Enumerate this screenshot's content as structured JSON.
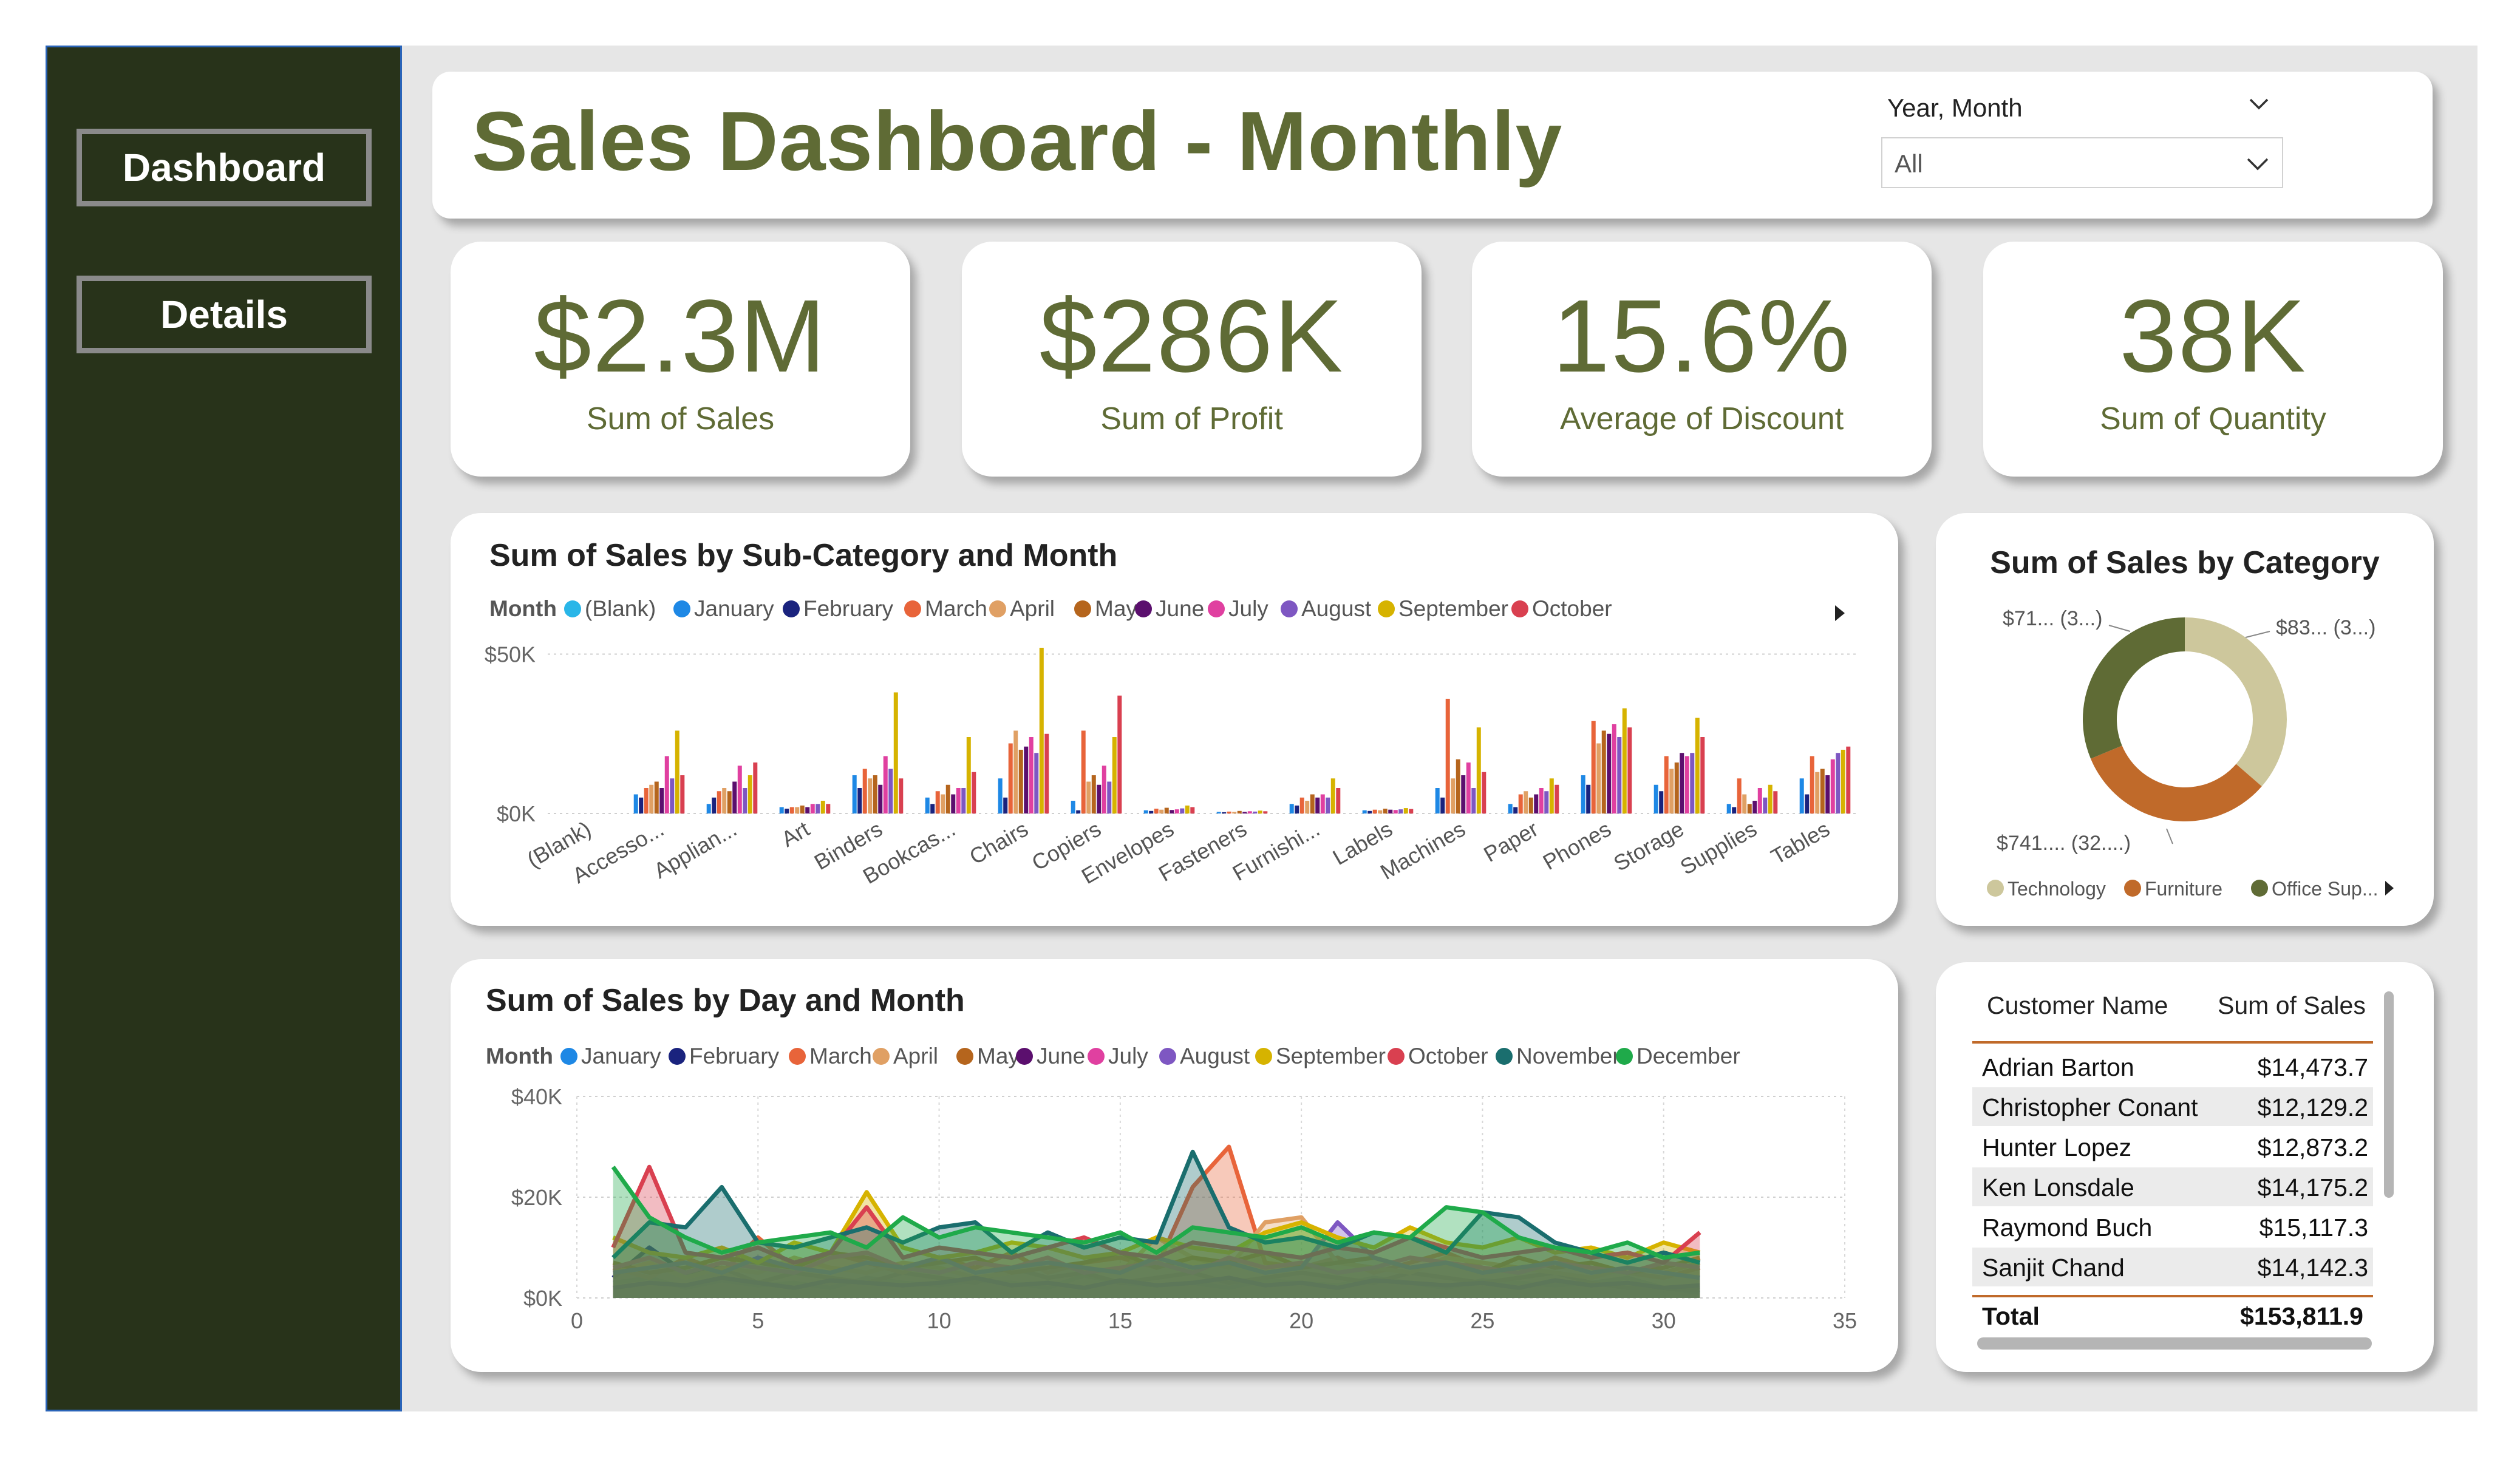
{
  "nav": {
    "dashboard_label": "Dashboard",
    "details_label": "Details"
  },
  "header": {
    "title": "Sales Dashboard - Monthly",
    "slicer_label": "Year, Month",
    "slicer_value": "All"
  },
  "kpis": [
    {
      "value": "$2.3M",
      "label": "Sum of Sales"
    },
    {
      "value": "$286K",
      "label": "Sum of Profit"
    },
    {
      "value": "15.6%",
      "label": "Average of Discount"
    },
    {
      "value": "38K",
      "label": "Sum of Quantity"
    }
  ],
  "colors": {
    "accent": "#5f6b35",
    "sidebar": "#28331a",
    "(Blank)": "#29b6e8",
    "January": "#1e88e5",
    "February": "#1a237e",
    "March": "#e8643a",
    "April": "#e0a064",
    "May": "#b5651d",
    "June": "#5b0f6e",
    "July": "#e040a0",
    "August": "#7e57c2",
    "September": "#d6b300",
    "October": "#d94050",
    "November": "#1a6e6e",
    "December": "#1faa4a",
    "Technology": "#cdc79c",
    "Furniture": "#c06a2a",
    "Office Supplies": "#5f6b35"
  },
  "chart_data": [
    {
      "type": "bar",
      "title": "Sum of Sales by Sub-Category and Month",
      "legend_title": "Month",
      "legend": [
        "(Blank)",
        "January",
        "February",
        "March",
        "April",
        "May",
        "June",
        "July",
        "August",
        "September",
        "October"
      ],
      "categories": [
        "(Blank)",
        "Accesso...",
        "Applian...",
        "Art",
        "Binders",
        "Bookcas...",
        "Chairs",
        "Copiers",
        "Envelopes",
        "Fasteners",
        "Furnishi...",
        "Labels",
        "Machines",
        "Paper",
        "Phones",
        "Storage",
        "Supplies",
        "Tables"
      ],
      "y_ticks": [
        "$0K",
        "$50K"
      ],
      "ylim": [
        0,
        60000
      ],
      "series": [
        {
          "name": "(Blank)",
          "values": [
            0,
            0,
            0,
            0,
            0,
            0,
            0,
            0,
            0,
            0,
            0,
            0,
            0,
            0,
            0,
            0,
            0,
            0
          ]
        },
        {
          "name": "January",
          "values": [
            0,
            6000,
            3000,
            2000,
            12000,
            5000,
            11000,
            4000,
            1000,
            500,
            3000,
            1000,
            8000,
            3000,
            12000,
            9000,
            3000,
            11000
          ]
        },
        {
          "name": "February",
          "values": [
            0,
            5000,
            5000,
            1500,
            8000,
            3000,
            5000,
            1000,
            800,
            400,
            2500,
            800,
            5000,
            2000,
            9000,
            7000,
            2000,
            6000
          ]
        },
        {
          "name": "March",
          "values": [
            0,
            8000,
            7000,
            2000,
            14000,
            7000,
            22000,
            26000,
            1500,
            600,
            5000,
            1200,
            36000,
            6000,
            29000,
            18000,
            11000,
            18000
          ]
        },
        {
          "name": "April",
          "values": [
            0,
            9000,
            8000,
            2000,
            11000,
            6000,
            26000,
            10000,
            1200,
            500,
            4000,
            1000,
            11000,
            7000,
            22000,
            14000,
            6000,
            13000
          ]
        },
        {
          "name": "May",
          "values": [
            0,
            10000,
            7000,
            2500,
            12000,
            9000,
            20000,
            12000,
            1800,
            800,
            6000,
            1500,
            17000,
            5000,
            26000,
            16000,
            3000,
            14000
          ]
        },
        {
          "name": "June",
          "values": [
            0,
            8000,
            10000,
            2000,
            9000,
            6000,
            21000,
            9000,
            1100,
            500,
            5000,
            1200,
            12000,
            6000,
            25000,
            19000,
            4000,
            12000
          ]
        },
        {
          "name": "July",
          "values": [
            0,
            18000,
            15000,
            3000,
            18000,
            8000,
            24000,
            15000,
            1300,
            700,
            6000,
            1100,
            16000,
            8000,
            28000,
            18000,
            8000,
            17000
          ]
        },
        {
          "name": "August",
          "values": [
            0,
            11000,
            8000,
            3000,
            14000,
            8000,
            19000,
            10000,
            1600,
            600,
            5000,
            1300,
            8000,
            7000,
            24000,
            19000,
            5000,
            19000
          ]
        },
        {
          "name": "September",
          "values": [
            0,
            26000,
            12000,
            4000,
            38000,
            24000,
            52000,
            24000,
            2500,
            900,
            11000,
            1700,
            27000,
            11000,
            33000,
            30000,
            9000,
            20000
          ]
        },
        {
          "name": "October",
          "values": [
            0,
            12000,
            16000,
            3000,
            11000,
            13000,
            25000,
            37000,
            2000,
            700,
            8000,
            1400,
            13000,
            9000,
            27000,
            24000,
            7000,
            21000
          ]
        }
      ]
    },
    {
      "type": "donut",
      "title": "Sum of Sales by Category",
      "slices": [
        {
          "name": "Technology",
          "value": 836154,
          "label": "$83... (3...)"
        },
        {
          "name": "Furniture",
          "value": 741999,
          "label": "$741.... (32....)"
        },
        {
          "name": "Office Supplies",
          "value": 719047,
          "label": "$71... (3...)"
        }
      ],
      "legend": [
        "Technology",
        "Furniture",
        "Office Sup..."
      ]
    },
    {
      "type": "area",
      "title": "Sum of Sales by Day and Month",
      "legend_title": "Month",
      "legend": [
        "January",
        "February",
        "March",
        "April",
        "May",
        "June",
        "July",
        "August",
        "September",
        "October",
        "November",
        "December"
      ],
      "x_ticks": [
        "0",
        "5",
        "10",
        "15",
        "20",
        "25",
        "30",
        "35"
      ],
      "y_ticks": [
        "$0K",
        "$20K",
        "$40K"
      ],
      "xlim": [
        0,
        35
      ],
      "ylim": [
        0,
        40000
      ],
      "x": [
        1,
        2,
        3,
        4,
        5,
        6,
        7,
        8,
        9,
        10,
        11,
        12,
        13,
        14,
        15,
        16,
        17,
        18,
        19,
        20,
        21,
        22,
        23,
        24,
        25,
        26,
        27,
        28,
        29,
        30,
        31
      ],
      "series": [
        {
          "name": "January",
          "values": [
            3000,
            4000,
            2000,
            3500,
            2500,
            3000,
            2000,
            4000,
            3000,
            2500,
            3500,
            3000,
            2000,
            4500,
            3000,
            2500,
            3000,
            2000,
            3500,
            3000,
            2500,
            4000,
            3000,
            2000,
            3500,
            3000,
            2500,
            3000,
            4000,
            2000,
            1000
          ]
        },
        {
          "name": "February",
          "values": [
            4000,
            10000,
            5000,
            6000,
            3000,
            5000,
            4000,
            3000,
            5000,
            4000,
            3000,
            6000,
            4000,
            5000,
            3000,
            4000,
            5000,
            3000,
            4000,
            5000,
            4000,
            3000,
            5000,
            4000,
            3000,
            4000,
            5000,
            3000,
            2000,
            2000,
            1500
          ]
        },
        {
          "name": "March",
          "values": [
            6000,
            4000,
            8000,
            5000,
            12000,
            6000,
            9000,
            7000,
            5000,
            8000,
            6000,
            9000,
            5000,
            7000,
            8000,
            6000,
            22000,
            30000,
            7000,
            6000,
            8000,
            5000,
            7000,
            9000,
            6000,
            5000,
            8000,
            6000,
            5000,
            4000,
            6000
          ]
        },
        {
          "name": "April",
          "values": [
            5000,
            7000,
            4000,
            6000,
            5000,
            8000,
            6000,
            5000,
            7000,
            6000,
            4000,
            5000,
            7000,
            6000,
            5000,
            12000,
            8000,
            6000,
            15000,
            16000,
            7000,
            6000,
            5000,
            8000,
            7000,
            6000,
            5000,
            4000,
            6000,
            5000,
            7000
          ]
        },
        {
          "name": "May",
          "values": [
            7000,
            5000,
            6000,
            8000,
            7000,
            6000,
            9000,
            8000,
            6000,
            7000,
            8000,
            5000,
            6000,
            7000,
            9000,
            6000,
            8000,
            7000,
            9000,
            6000,
            7000,
            8000,
            6000,
            7000,
            5000,
            8000,
            6000,
            7000,
            5000,
            6000,
            8000
          ]
        },
        {
          "name": "June",
          "values": [
            2000,
            3000,
            2500,
            4000,
            3000,
            2000,
            3500,
            3000,
            2500,
            3000,
            4000,
            2500,
            3000,
            2000,
            3500,
            2500,
            3000,
            4000,
            2500,
            3000,
            2000,
            3500,
            3000,
            2500,
            3000,
            2000,
            3500,
            2500,
            3000,
            2000,
            2500
          ]
        },
        {
          "name": "July",
          "values": [
            6000,
            8000,
            5000,
            7000,
            6000,
            5000,
            8000,
            9000,
            6000,
            5000,
            7000,
            6000,
            8000,
            5000,
            6000,
            7000,
            5000,
            8000,
            6000,
            7000,
            5000,
            6000,
            8000,
            7000,
            6000,
            5000,
            7000,
            6000,
            5000,
            7000,
            6000
          ]
        },
        {
          "name": "August",
          "values": [
            5000,
            6000,
            7000,
            5000,
            8000,
            6000,
            5000,
            7000,
            6000,
            8000,
            5000,
            6000,
            7000,
            6000,
            5000,
            8000,
            6000,
            7000,
            5000,
            6000,
            15000,
            8000,
            6000,
            7000,
            5000,
            6000,
            7000,
            5000,
            6000,
            5000,
            4000
          ]
        },
        {
          "name": "September",
          "values": [
            12000,
            9000,
            8000,
            10000,
            7000,
            11000,
            9000,
            21000,
            10000,
            8000,
            9000,
            11000,
            10000,
            8000,
            9000,
            12000,
            10000,
            9000,
            13000,
            15000,
            12000,
            10000,
            14000,
            11000,
            10000,
            12000,
            9000,
            10000,
            8000,
            11000,
            9000
          ]
        },
        {
          "name": "October",
          "values": [
            10000,
            26000,
            9000,
            8000,
            10000,
            7000,
            9000,
            18000,
            8000,
            10000,
            9000,
            8000,
            10000,
            12000,
            9000,
            8000,
            11000,
            10000,
            9000,
            8000,
            10000,
            9000,
            12000,
            10000,
            8000,
            9000,
            10000,
            8000,
            9000,
            7000,
            13000
          ]
        },
        {
          "name": "November",
          "values": [
            8000,
            15000,
            14000,
            22000,
            11000,
            10000,
            12000,
            14000,
            11000,
            14000,
            15000,
            9000,
            13000,
            10000,
            12000,
            11000,
            29000,
            14000,
            11000,
            12000,
            10000,
            13000,
            12000,
            9000,
            17000,
            16000,
            11000,
            9000,
            7000,
            9000,
            7000
          ]
        },
        {
          "name": "December",
          "values": [
            26000,
            16000,
            12000,
            9000,
            11000,
            12000,
            13000,
            10000,
            16000,
            12000,
            14000,
            13000,
            12000,
            11000,
            13000,
            9000,
            14000,
            13000,
            12000,
            14000,
            11000,
            13000,
            12000,
            18000,
            17000,
            12000,
            10000,
            9000,
            11000,
            8000,
            9000
          ]
        }
      ]
    }
  ],
  "customer_table": {
    "headers": [
      "Customer Name",
      "Sum of Sales"
    ],
    "rows": [
      {
        "name": "Adrian Barton",
        "sales": "$14,473.7"
      },
      {
        "name": "Christopher Conant",
        "sales": "$12,129.2"
      },
      {
        "name": "Hunter Lopez",
        "sales": "$12,873.2"
      },
      {
        "name": "Ken Lonsdale",
        "sales": "$14,175.2"
      },
      {
        "name": "Raymond Buch",
        "sales": "$15,117.3"
      },
      {
        "name": "Sanjit Chand",
        "sales": "$14,142.3"
      }
    ],
    "total_label": "Total",
    "total_value": "$153,811.9"
  }
}
